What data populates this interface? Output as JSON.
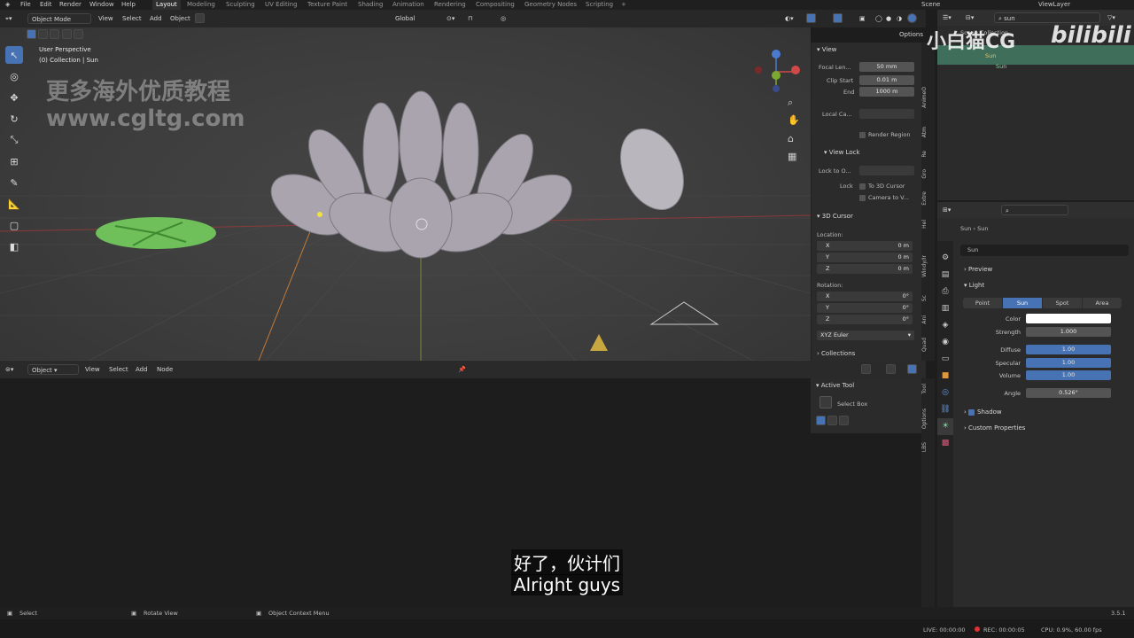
{
  "menu": [
    "File",
    "Edit",
    "Render",
    "Window",
    "Help"
  ],
  "workspaces": [
    "Layout",
    "Modeling",
    "Sculpting",
    "UV Editing",
    "Texture Paint",
    "Shading",
    "Animation",
    "Rendering",
    "Compositing",
    "Geometry Nodes",
    "Scripting"
  ],
  "active_workspace": "Layout",
  "scene_name": "Scene",
  "view_layer": "ViewLayer",
  "viewport": {
    "mode": "Object Mode",
    "menus": [
      "View",
      "Select",
      "Add",
      "Object"
    ],
    "transform": "Global",
    "options": "Options",
    "title": "User Perspective",
    "subtitle": "(0) Collection | Sun",
    "watermark_line1": "更多海外优质教程",
    "watermark_line2": "www.cgltg.com"
  },
  "npanel": {
    "view_header": "View",
    "focal_label": "Focal Len...",
    "focal_value": "50 mm",
    "clip_start_label": "Clip Start",
    "clip_start_value": "0.01 m",
    "end_label": "End",
    "end_value": "1000 m",
    "local_camera_label": "Local Ca...",
    "render_region": "Render Region",
    "view_lock": "View Lock",
    "lock_to_object": "Lock to O...",
    "lock_label": "Lock",
    "to_3d_cursor": "To 3D Cursor",
    "camera_to_view": "Camera to V...",
    "cursor_header": "3D Cursor",
    "location_label": "Location:",
    "x_label": "X",
    "y_label": "Y",
    "z_label": "Z",
    "loc_x": "0 m",
    "loc_y": "0 m",
    "loc_z": "0 m",
    "rotation_label": "Rotation:",
    "rot_x": "0°",
    "rot_y": "0°",
    "rot_z": "0°",
    "rotation_mode": "XYZ Euler",
    "collections": "Collections"
  },
  "viewport_tabs": [
    "AnimeO",
    "Atm",
    "Re",
    "Gro",
    "Extre",
    "Hel",
    "Windy/Ir",
    "Sc",
    "Ani",
    "Quad"
  ],
  "node_editor": {
    "type": "Object",
    "menus": [
      "View",
      "Select",
      "Add",
      "Node"
    ],
    "active_tool": "Active Tool",
    "tool_name": "Select Box",
    "tabs": [
      "Tool",
      "Options",
      "LBS"
    ]
  },
  "outliner": {
    "search_value": "sun",
    "scene_collection": "Scene Collection",
    "item1": "Sun",
    "item2": "Sun",
    "watermark_brand": "小白猫CG",
    "watermark_site": "bilibili"
  },
  "properties": {
    "breadcrumb_a": "Sun",
    "breadcrumb_b": "Sun",
    "data_name": "Sun",
    "preview": "Preview",
    "light": "Light",
    "light_types": [
      "Point",
      "Sun",
      "Spot",
      "Area"
    ],
    "active_light_type": "Sun",
    "color_label": "Color",
    "strength_label": "Strength",
    "strength_value": "1.000",
    "diffuse_label": "Diffuse",
    "diffuse_value": "1.00",
    "specular_label": "Specular",
    "specular_value": "1.00",
    "volume_label": "Volume",
    "volume_value": "1.00",
    "angle_label": "Angle",
    "angle_value": "0.526°",
    "shadow": "Shadow",
    "custom_props": "Custom Properties",
    "light_color": "#ffffff"
  },
  "statusbar": {
    "select": "Select",
    "rotate": "Rotate View",
    "context": "Object Context Menu",
    "version": "3.5.1"
  },
  "bottom": {
    "live": "LIVE: 00:00:00",
    "rec": "REC: 00:00:05",
    "cpu": "CPU: 0.9%, 60.00 fps"
  },
  "subtitles": {
    "cn": "好了，伙计们",
    "en": "Alright guys"
  },
  "colors": {
    "accent": "#4772b3",
    "outliner_highlight": "#3f6f5a"
  }
}
